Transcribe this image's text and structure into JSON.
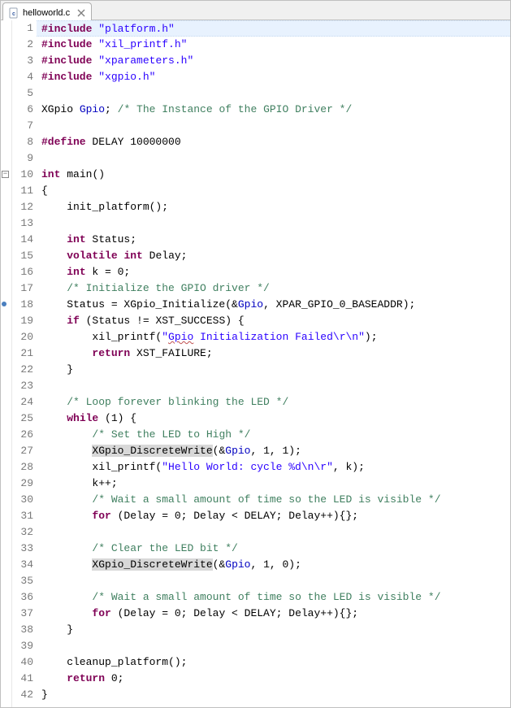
{
  "tab": {
    "filename": "helloworld.c",
    "close_glyph": "✕"
  },
  "gutter": {
    "start": 1,
    "end": 42,
    "fold_lines": [
      10
    ],
    "marker_lines": [
      18
    ]
  },
  "code": {
    "lines": [
      {
        "n": 1,
        "hl": true,
        "tokens": [
          [
            "kw",
            "#include"
          ],
          [
            "id",
            " "
          ],
          [
            "str",
            "\"platform.h\""
          ]
        ]
      },
      {
        "n": 2,
        "tokens": [
          [
            "kw",
            "#include"
          ],
          [
            "id",
            " "
          ],
          [
            "str",
            "\"xil_printf.h\""
          ]
        ]
      },
      {
        "n": 3,
        "tokens": [
          [
            "kw",
            "#include"
          ],
          [
            "id",
            " "
          ],
          [
            "str",
            "\"xparameters.h\""
          ]
        ]
      },
      {
        "n": 4,
        "tokens": [
          [
            "kw",
            "#include"
          ],
          [
            "id",
            " "
          ],
          [
            "str",
            "\"xgpio.h\""
          ]
        ]
      },
      {
        "n": 5,
        "tokens": []
      },
      {
        "n": 6,
        "tokens": [
          [
            "id",
            "XGpio "
          ],
          [
            "var",
            "Gpio"
          ],
          [
            "id",
            "; "
          ],
          [
            "cm",
            "/* The Instance of the GPIO Driver */"
          ]
        ]
      },
      {
        "n": 7,
        "tokens": []
      },
      {
        "n": 8,
        "tokens": [
          [
            "kw",
            "#define"
          ],
          [
            "id",
            " DELAY 10000000"
          ]
        ]
      },
      {
        "n": 9,
        "tokens": []
      },
      {
        "n": 10,
        "tokens": [
          [
            "kw",
            "int"
          ],
          [
            "id",
            " "
          ],
          [
            "def",
            "main"
          ],
          [
            "id",
            "()"
          ]
        ]
      },
      {
        "n": 11,
        "tokens": [
          [
            "id",
            "{"
          ]
        ]
      },
      {
        "n": 12,
        "tokens": [
          [
            "id",
            "    init_platform();"
          ]
        ]
      },
      {
        "n": 13,
        "tokens": []
      },
      {
        "n": 14,
        "tokens": [
          [
            "id",
            "    "
          ],
          [
            "kw",
            "int"
          ],
          [
            "id",
            " Status;"
          ]
        ]
      },
      {
        "n": 15,
        "tokens": [
          [
            "id",
            "    "
          ],
          [
            "kw",
            "volatile"
          ],
          [
            "id",
            " "
          ],
          [
            "kw",
            "int"
          ],
          [
            "id",
            " Delay;"
          ]
        ]
      },
      {
        "n": 16,
        "tokens": [
          [
            "id",
            "    "
          ],
          [
            "kw",
            "int"
          ],
          [
            "id",
            " k = 0;"
          ]
        ]
      },
      {
        "n": 17,
        "tokens": [
          [
            "id",
            "    "
          ],
          [
            "cm",
            "/* Initialize the GPIO driver */"
          ]
        ]
      },
      {
        "n": 18,
        "tokens": [
          [
            "id",
            "    Status = XGpio_Initialize(&"
          ],
          [
            "var",
            "Gpio"
          ],
          [
            "id",
            ", XPAR_GPIO_0_BASEADDR);"
          ]
        ]
      },
      {
        "n": 19,
        "tokens": [
          [
            "id",
            "    "
          ],
          [
            "kw",
            "if"
          ],
          [
            "id",
            " (Status != XST_SUCCESS) {"
          ]
        ]
      },
      {
        "n": 20,
        "tokens": [
          [
            "id",
            "        xil_printf("
          ],
          [
            "str",
            "\""
          ],
          [
            "str wavy",
            "Gpio"
          ],
          [
            "str",
            " Initialization Failed\\r\\n\""
          ],
          [
            "id",
            ");"
          ]
        ]
      },
      {
        "n": 21,
        "tokens": [
          [
            "id",
            "        "
          ],
          [
            "kw",
            "return"
          ],
          [
            "id",
            " XST_FAILURE;"
          ]
        ]
      },
      {
        "n": 22,
        "tokens": [
          [
            "id",
            "    }"
          ]
        ]
      },
      {
        "n": 23,
        "tokens": []
      },
      {
        "n": 24,
        "tokens": [
          [
            "id",
            "    "
          ],
          [
            "cm",
            "/* Loop forever blinking the LED */"
          ]
        ]
      },
      {
        "n": 25,
        "tokens": [
          [
            "id",
            "    "
          ],
          [
            "kw",
            "while"
          ],
          [
            "id",
            " (1) {"
          ]
        ]
      },
      {
        "n": 26,
        "tokens": [
          [
            "id",
            "        "
          ],
          [
            "cm",
            "/* Set the LED to High */"
          ]
        ]
      },
      {
        "n": 27,
        "tokens": [
          [
            "id",
            "        "
          ],
          [
            "sel",
            "XGpio_DiscreteWrite"
          ],
          [
            "id",
            "(&"
          ],
          [
            "var",
            "Gpio"
          ],
          [
            "id",
            ", 1, 1);"
          ]
        ]
      },
      {
        "n": 28,
        "tokens": [
          [
            "id",
            "        xil_printf("
          ],
          [
            "str",
            "\"Hello World: cycle %d\\n\\r\""
          ],
          [
            "id",
            ", k);"
          ]
        ]
      },
      {
        "n": 29,
        "tokens": [
          [
            "id",
            "        k++;"
          ]
        ]
      },
      {
        "n": 30,
        "tokens": [
          [
            "id",
            "        "
          ],
          [
            "cm",
            "/* Wait a small amount of time so the LED is visible */"
          ]
        ]
      },
      {
        "n": 31,
        "tokens": [
          [
            "id",
            "        "
          ],
          [
            "kw",
            "for"
          ],
          [
            "id",
            " (Delay = 0; Delay < DELAY; Delay++){};"
          ]
        ]
      },
      {
        "n": 32,
        "tokens": []
      },
      {
        "n": 33,
        "tokens": [
          [
            "id",
            "        "
          ],
          [
            "cm",
            "/* Clear the LED bit */"
          ]
        ]
      },
      {
        "n": 34,
        "tokens": [
          [
            "id",
            "        "
          ],
          [
            "sel",
            "XGpio_DiscreteWrite"
          ],
          [
            "id",
            "(&"
          ],
          [
            "var",
            "Gpio"
          ],
          [
            "id",
            ", 1, 0);"
          ]
        ]
      },
      {
        "n": 35,
        "tokens": []
      },
      {
        "n": 36,
        "tokens": [
          [
            "id",
            "        "
          ],
          [
            "cm",
            "/* Wait a small amount of time so the LED is visible */"
          ]
        ]
      },
      {
        "n": 37,
        "tokens": [
          [
            "id",
            "        "
          ],
          [
            "kw",
            "for"
          ],
          [
            "id",
            " (Delay = 0; Delay < DELAY; Delay++){};"
          ]
        ]
      },
      {
        "n": 38,
        "tokens": [
          [
            "id",
            "    }"
          ]
        ]
      },
      {
        "n": 39,
        "tokens": []
      },
      {
        "n": 40,
        "tokens": [
          [
            "id",
            "    cleanup_platform();"
          ]
        ]
      },
      {
        "n": 41,
        "tokens": [
          [
            "id",
            "    "
          ],
          [
            "kw",
            "return"
          ],
          [
            "id",
            " 0;"
          ]
        ]
      },
      {
        "n": 42,
        "tokens": [
          [
            "id",
            "}"
          ]
        ]
      }
    ]
  }
}
